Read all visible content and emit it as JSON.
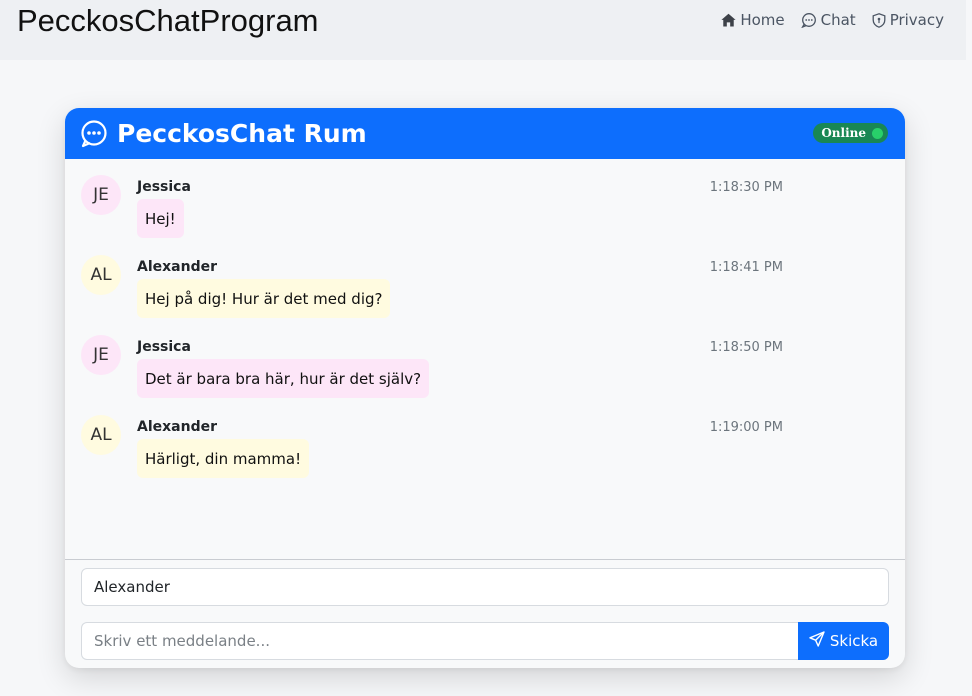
{
  "app": {
    "brand": "PecckosChatProgram"
  },
  "nav": {
    "items": [
      {
        "label": "Home",
        "icon": "home-icon"
      },
      {
        "label": "Chat",
        "icon": "chat-icon"
      },
      {
        "label": "Privacy",
        "icon": "shield-icon"
      }
    ]
  },
  "chat": {
    "title": "PecckosChat Rum",
    "status": "Online",
    "colors": {
      "header": "#0d6efd",
      "online_badge": "#198754",
      "jessica_bubble": "#fde6f8",
      "alexander_bubble": "#fffbe0"
    },
    "messages": [
      {
        "initials": "JE",
        "sender": "Jessica",
        "time": "1:18:30 PM",
        "text": "Hej!"
      },
      {
        "initials": "AL",
        "sender": "Alexander",
        "time": "1:18:41 PM",
        "text": "Hej på dig! Hur är det med dig?"
      },
      {
        "initials": "JE",
        "sender": "Jessica",
        "time": "1:18:50 PM",
        "text": "Det är bara bra här, hur är det själv?"
      },
      {
        "initials": "AL",
        "sender": "Alexander",
        "time": "1:19:00 PM",
        "text": "Härligt, din mamma!"
      }
    ]
  },
  "form": {
    "name_value": "Alexander",
    "message_placeholder": "Skriv ett meddelande...",
    "send_label": "Skicka"
  }
}
